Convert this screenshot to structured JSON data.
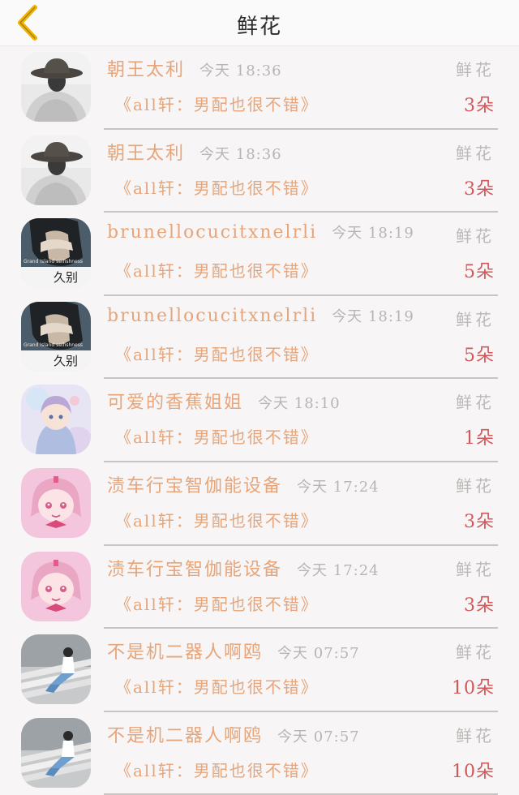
{
  "header": {
    "title": "鲜花"
  },
  "rows": [
    {
      "name": "朝王太利",
      "time": "今天 18:36",
      "gift_type": "鲜花",
      "book": "《all轩：男配也很不错》",
      "count": "3朵",
      "avatar": "woman-hat"
    },
    {
      "name": "朝王太利",
      "time": "今天 18:36",
      "gift_type": "鲜花",
      "book": "《all轩：男配也很不错》",
      "count": "3朵",
      "avatar": "woman-hat"
    },
    {
      "name": "brunellocucitxnelrli",
      "time": "今天 18:19",
      "gift_type": "鲜花",
      "book": "《all轩：男配也很不错》",
      "count": "5朵",
      "avatar": "face-cover",
      "avatar_caption": "久别",
      "avatar_small": "Grand Island selfishness"
    },
    {
      "name": "brunellocucitxnelrli",
      "time": "今天 18:19",
      "gift_type": "鲜花",
      "book": "《all轩：男配也很不错》",
      "count": "5朵",
      "avatar": "face-cover",
      "avatar_caption": "久别",
      "avatar_small": "Grand Island selfishness"
    },
    {
      "name": "可爱的香蕉姐姐",
      "time": "今天 18:10",
      "gift_type": "鲜花",
      "book": "《all轩：男配也很不错》",
      "count": "1朵",
      "avatar": "anime-blue"
    },
    {
      "name": "渍车行宝智伽能设备",
      "time": "今天 17:24",
      "gift_type": "鲜花",
      "book": "《all轩：男配也很不错》",
      "count": "3朵",
      "avatar": "anime-pink"
    },
    {
      "name": "渍车行宝智伽能设备",
      "time": "今天 17:24",
      "gift_type": "鲜花",
      "book": "《all轩：男配也很不错》",
      "count": "3朵",
      "avatar": "anime-pink"
    },
    {
      "name": "不是机二器人啊鸥",
      "time": "今天 07:57",
      "gift_type": "鲜花",
      "book": "《all轩：男配也很不错》",
      "count": "10朵",
      "avatar": "man-stairs"
    },
    {
      "name": "不是机二器人啊鸥",
      "time": "今天 07:57",
      "gift_type": "鲜花",
      "book": "《all轩：男配也很不错》",
      "count": "10朵",
      "avatar": "man-stairs"
    }
  ],
  "colors": {
    "accent": "#e6a57a",
    "count": "#d2575b",
    "muted": "#b9b4b4",
    "back_arrow": "#f0b400"
  }
}
